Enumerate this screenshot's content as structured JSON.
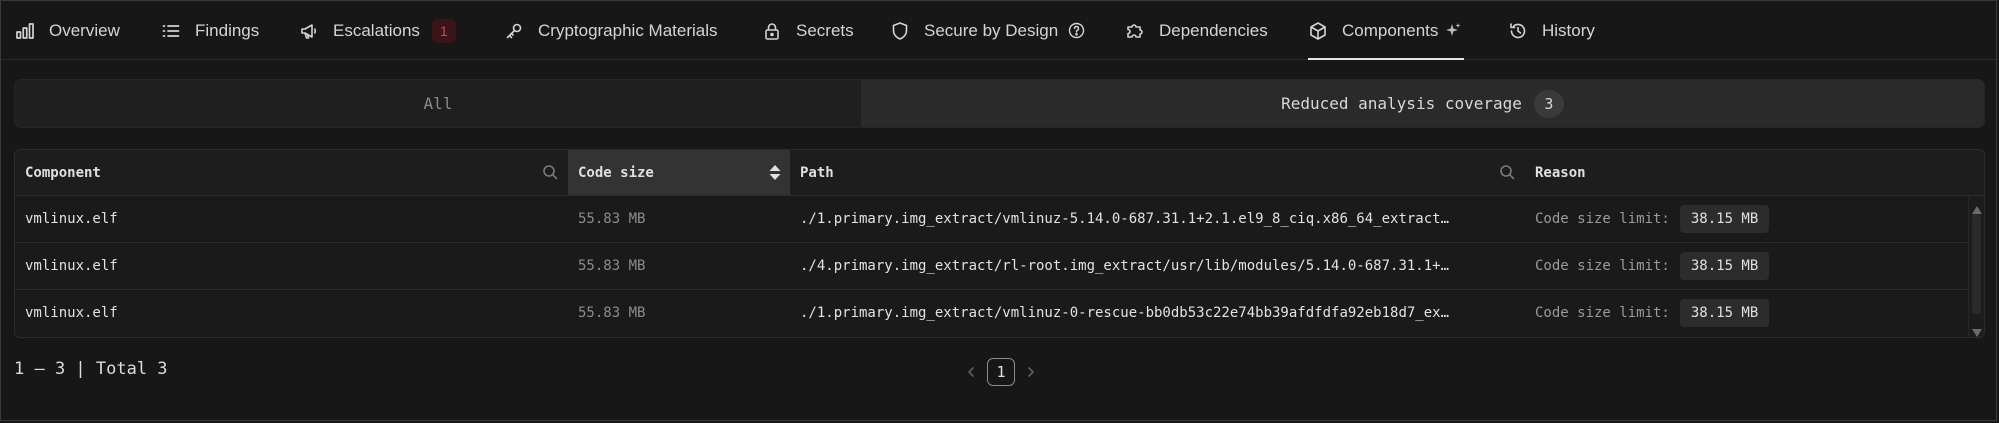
{
  "nav": {
    "tabs": [
      {
        "label": "Overview",
        "icon": "bar-chart-icon"
      },
      {
        "label": "Findings",
        "icon": "list-icon"
      },
      {
        "label": "Escalations",
        "icon": "megaphone-icon",
        "badge": "1"
      },
      {
        "label": "Cryptographic Materials",
        "icon": "key-icon"
      },
      {
        "label": "Secrets",
        "icon": "lock-icon"
      },
      {
        "label": "Secure by Design",
        "icon": "shield-icon"
      },
      {
        "label": "Dependencies",
        "icon": "puzzle-icon"
      },
      {
        "label": "Components",
        "icon": "cube-icon",
        "active": true
      },
      {
        "label": "History",
        "icon": "history-icon"
      }
    ]
  },
  "filter": {
    "all_label": "All",
    "reduced_label": "Reduced analysis coverage",
    "reduced_count": "3"
  },
  "table": {
    "columns": {
      "component": "Component",
      "code_size": "Code size",
      "path": "Path",
      "reason": "Reason"
    },
    "rows": [
      {
        "component": "vmlinux.elf",
        "code_size": "55.83 MB",
        "path": "./1.primary.img_extract/vmlinuz-5.14.0-687.31.1+2.1.el9_8_ciq.x86_64_extract…",
        "reason_label": "Code size limit:",
        "reason_value": "38.15 MB"
      },
      {
        "component": "vmlinux.elf",
        "code_size": "55.83 MB",
        "path": "./4.primary.img_extract/rl-root.img_extract/usr/lib/modules/5.14.0-687.31.1+…",
        "reason_label": "Code size limit:",
        "reason_value": "38.15 MB"
      },
      {
        "component": "vmlinux.elf",
        "code_size": "55.83 MB",
        "path": "./1.primary.img_extract/vmlinuz-0-rescue-bb0db53c22e74bb39afdfdfa92eb18d7_ex…",
        "reason_label": "Code size limit:",
        "reason_value": "38.15 MB"
      }
    ]
  },
  "footer": {
    "range_text": "1 – 3 | Total 3",
    "current_page": "1"
  },
  "colors": {
    "background": "#171717",
    "badge_bg": "#3a1416",
    "badge_text": "#d0484e",
    "active_underline": "#e6e6e6"
  }
}
